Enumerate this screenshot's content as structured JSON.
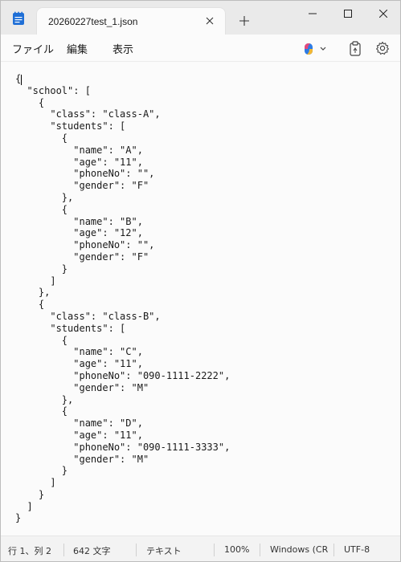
{
  "tab": {
    "title": "20260227test_1.json"
  },
  "menu": {
    "file": "ファイル",
    "edit": "編集",
    "view": "表示"
  },
  "editor": {
    "lines": [
      "{",
      "  \"school\": [",
      "    {",
      "      \"class\": \"class-A\",",
      "      \"students\": [",
      "        {",
      "          \"name\": \"A\",",
      "          \"age\": \"11\",",
      "          \"phoneNo\": \"\",",
      "          \"gender\": \"F\"",
      "        },",
      "        {",
      "          \"name\": \"B\",",
      "          \"age\": \"12\",",
      "          \"phoneNo\": \"\",",
      "          \"gender\": \"F\"",
      "        }",
      "      ]",
      "    },",
      "    {",
      "      \"class\": \"class-B\",",
      "      \"students\": [",
      "        {",
      "          \"name\": \"C\",",
      "          \"age\": \"11\",",
      "          \"phoneNo\": \"090-1111-2222\",",
      "          \"gender\": \"M\"",
      "        },",
      "        {",
      "          \"name\": \"D\",",
      "          \"age\": \"11\",",
      "          \"phoneNo\": \"090-1111-3333\",",
      "          \"gender\": \"M\"",
      "        }",
      "      ]",
      "    }",
      "  ]",
      "}"
    ]
  },
  "status": {
    "position": "行 1、列 2",
    "chars": "642 文字",
    "format": "テキスト",
    "zoom": "100%",
    "line_ending": "Windows (CR",
    "encoding": "UTF-8"
  },
  "icons": {
    "app": "notepad-icon",
    "close_tab": "close-icon",
    "new_tab": "plus-icon",
    "copilot": "copilot-icon",
    "clipboard": "clipboard-icon",
    "settings": "gear-icon"
  },
  "colors": {
    "accent": "#1f6fd6",
    "copilot_a": "#e5487a",
    "copilot_b": "#2d7be5"
  }
}
